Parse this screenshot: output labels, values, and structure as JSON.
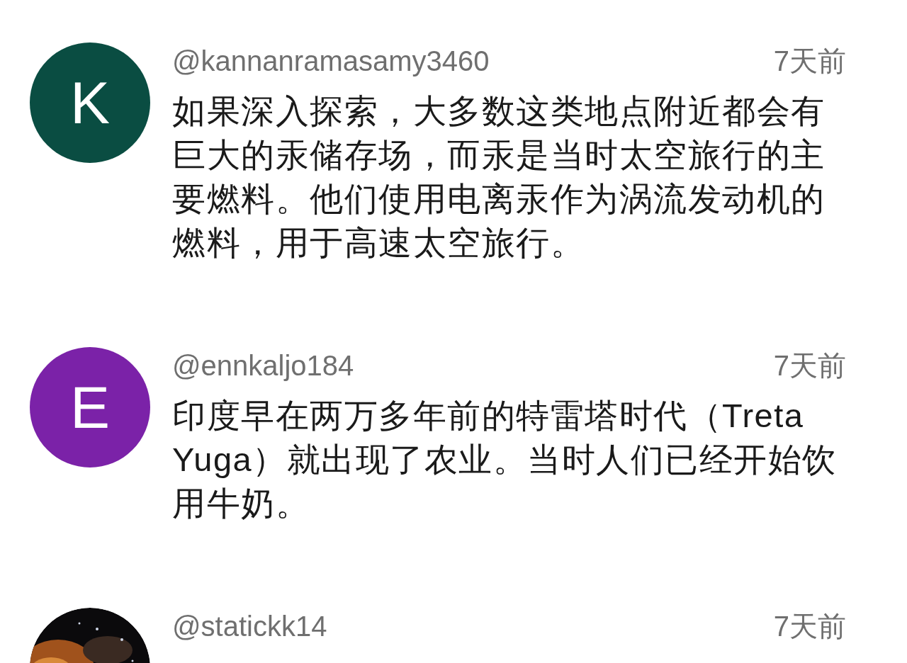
{
  "comments": [
    {
      "avatar": {
        "kind": "letter",
        "letter": "K",
        "color": "#0a4d42"
      },
      "author": "@kannanramasamy3460",
      "time": "7天前",
      "text": "如果深入探索，大多数这类地点附近都会有巨大的汞储存场，而汞是当时太空旅行的主要燃料。他们使用电离汞作为涡流发动机的燃料，用于高速太空旅行。"
    },
    {
      "avatar": {
        "kind": "letter",
        "letter": "E",
        "color": "#7b22a8"
      },
      "author": "@ennkaljo184",
      "time": "7天前",
      "text": "印度早在两万多年前的特雷塔时代（Treta Yuga）就出现了农业。当时人们已经开始饮用牛奶。"
    },
    {
      "author": "@statickk14",
      "time": "7天前"
    }
  ]
}
